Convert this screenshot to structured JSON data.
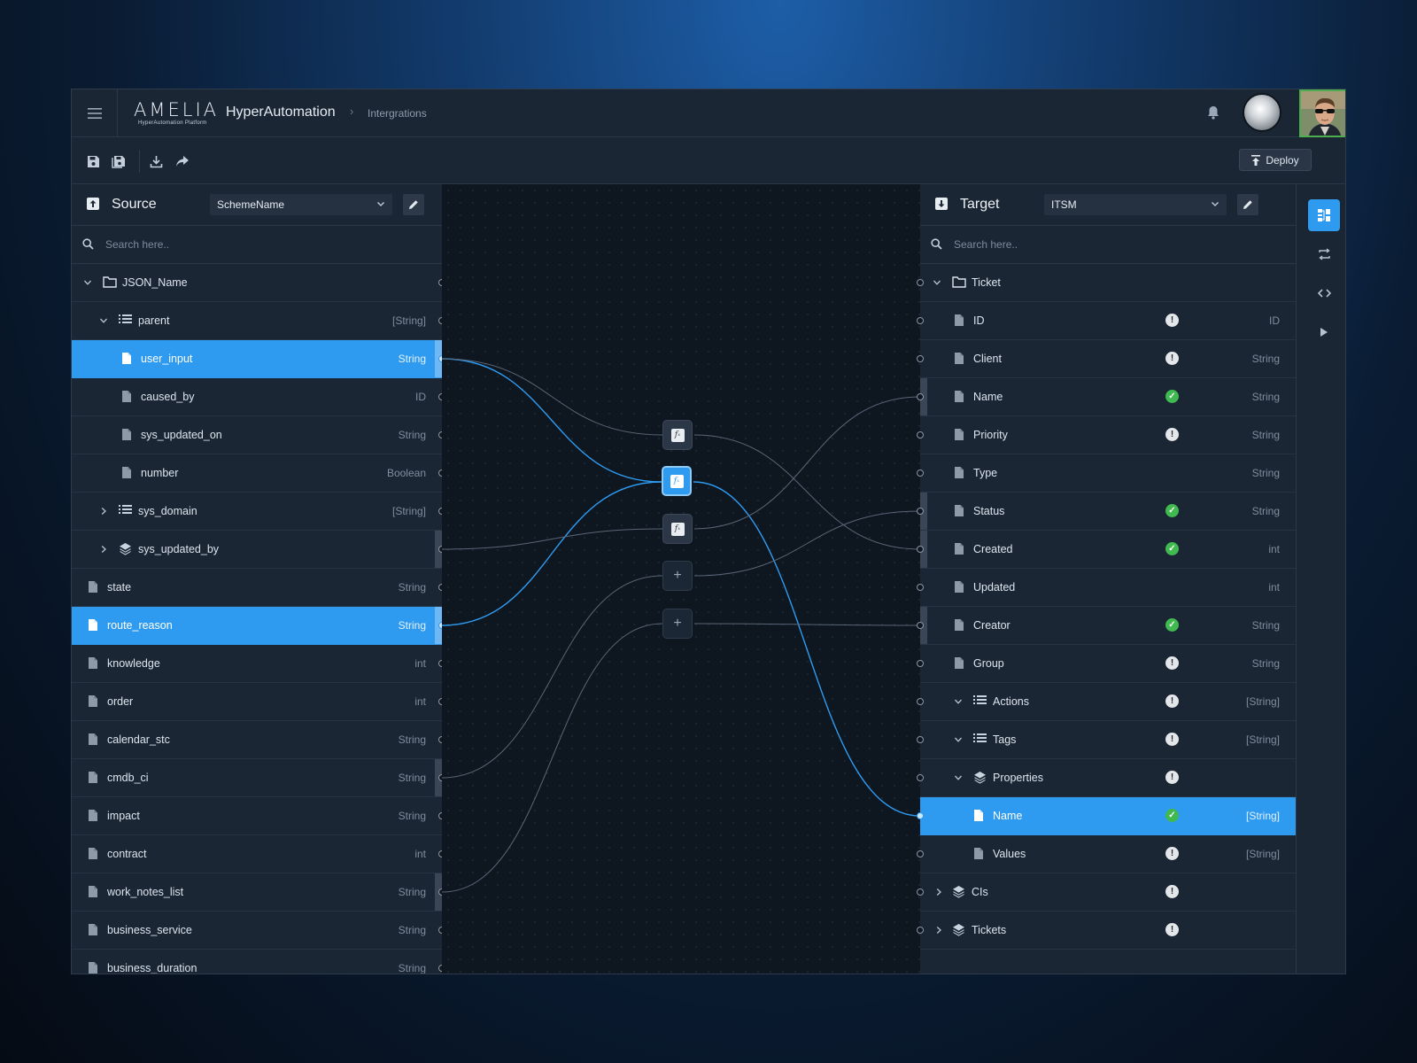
{
  "header": {
    "logo_text": "AMELIA",
    "logo_sub": "HyperAutomation Platform",
    "app_title": "HyperAutomation",
    "breadcrumb": "Intergrations"
  },
  "toolbar": {
    "deploy_label": "Deploy",
    "icons": [
      "save-icon",
      "save-all-icon",
      "download-icon",
      "share-icon"
    ]
  },
  "source": {
    "title": "Source",
    "scheme": "SchemeName",
    "search_placeholder": "Search here..",
    "rows": [
      {
        "label": "JSON_Name",
        "type": ""
      },
      {
        "label": "parent",
        "type": "[String]"
      },
      {
        "label": "user_input",
        "type": "String"
      },
      {
        "label": "caused_by",
        "type": "ID"
      },
      {
        "label": "sys_updated_on",
        "type": "String"
      },
      {
        "label": "number",
        "type": "Boolean"
      },
      {
        "label": "sys_domain",
        "type": "[String]"
      },
      {
        "label": "sys_updated_by",
        "type": ""
      },
      {
        "label": "state",
        "type": "String"
      },
      {
        "label": "route_reason",
        "type": "String"
      },
      {
        "label": "knowledge",
        "type": "int"
      },
      {
        "label": "order",
        "type": "int"
      },
      {
        "label": "calendar_stc",
        "type": "String"
      },
      {
        "label": "cmdb_ci",
        "type": "String"
      },
      {
        "label": "impact",
        "type": "String"
      },
      {
        "label": "contract",
        "type": "int"
      },
      {
        "label": "work_notes_list",
        "type": "String"
      },
      {
        "label": "business_service",
        "type": "String"
      },
      {
        "label": "business_duration",
        "type": "String"
      }
    ]
  },
  "target": {
    "title": "Target",
    "scheme": "ITSM",
    "search_placeholder": "Search here..",
    "rows": [
      {
        "label": "Ticket",
        "type": ""
      },
      {
        "label": "ID",
        "type": "ID"
      },
      {
        "label": "Client",
        "type": "String"
      },
      {
        "label": "Name",
        "type": "String"
      },
      {
        "label": "Priority",
        "type": "String"
      },
      {
        "label": "Type",
        "type": "String"
      },
      {
        "label": "Status",
        "type": "String"
      },
      {
        "label": "Created",
        "type": "int"
      },
      {
        "label": "Updated",
        "type": "int"
      },
      {
        "label": "Creator",
        "type": "String"
      },
      {
        "label": "Group",
        "type": "String"
      },
      {
        "label": "Actions",
        "type": "[String]"
      },
      {
        "label": "Tags",
        "type": "[String]"
      },
      {
        "label": "Properties",
        "type": ""
      },
      {
        "label": "Name",
        "type": "[String]"
      },
      {
        "label": "Values",
        "type": "[String]"
      },
      {
        "label": "CIs",
        "type": ""
      },
      {
        "label": "Tickets",
        "type": ""
      }
    ]
  },
  "colors": {
    "accent": "#2f9bf0",
    "ok": "#3fb950",
    "warn": "#e4e7ea"
  }
}
